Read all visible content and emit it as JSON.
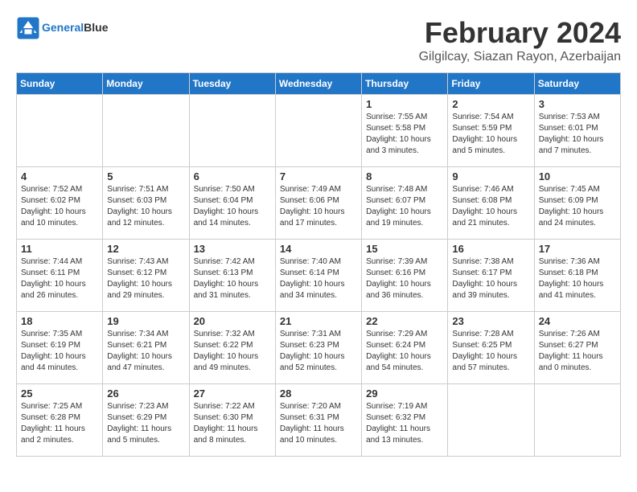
{
  "header": {
    "logo_general": "General",
    "logo_blue": "Blue",
    "month_title": "February 2024",
    "location": "Gilgilcay, Siazan Rayon, Azerbaijan"
  },
  "weekdays": [
    "Sunday",
    "Monday",
    "Tuesday",
    "Wednesday",
    "Thursday",
    "Friday",
    "Saturday"
  ],
  "weeks": [
    [
      {
        "day": "",
        "info": ""
      },
      {
        "day": "",
        "info": ""
      },
      {
        "day": "",
        "info": ""
      },
      {
        "day": "",
        "info": ""
      },
      {
        "day": "1",
        "info": "Sunrise: 7:55 AM\nSunset: 5:58 PM\nDaylight: 10 hours\nand 3 minutes."
      },
      {
        "day": "2",
        "info": "Sunrise: 7:54 AM\nSunset: 5:59 PM\nDaylight: 10 hours\nand 5 minutes."
      },
      {
        "day": "3",
        "info": "Sunrise: 7:53 AM\nSunset: 6:01 PM\nDaylight: 10 hours\nand 7 minutes."
      }
    ],
    [
      {
        "day": "4",
        "info": "Sunrise: 7:52 AM\nSunset: 6:02 PM\nDaylight: 10 hours\nand 10 minutes."
      },
      {
        "day": "5",
        "info": "Sunrise: 7:51 AM\nSunset: 6:03 PM\nDaylight: 10 hours\nand 12 minutes."
      },
      {
        "day": "6",
        "info": "Sunrise: 7:50 AM\nSunset: 6:04 PM\nDaylight: 10 hours\nand 14 minutes."
      },
      {
        "day": "7",
        "info": "Sunrise: 7:49 AM\nSunset: 6:06 PM\nDaylight: 10 hours\nand 17 minutes."
      },
      {
        "day": "8",
        "info": "Sunrise: 7:48 AM\nSunset: 6:07 PM\nDaylight: 10 hours\nand 19 minutes."
      },
      {
        "day": "9",
        "info": "Sunrise: 7:46 AM\nSunset: 6:08 PM\nDaylight: 10 hours\nand 21 minutes."
      },
      {
        "day": "10",
        "info": "Sunrise: 7:45 AM\nSunset: 6:09 PM\nDaylight: 10 hours\nand 24 minutes."
      }
    ],
    [
      {
        "day": "11",
        "info": "Sunrise: 7:44 AM\nSunset: 6:11 PM\nDaylight: 10 hours\nand 26 minutes."
      },
      {
        "day": "12",
        "info": "Sunrise: 7:43 AM\nSunset: 6:12 PM\nDaylight: 10 hours\nand 29 minutes."
      },
      {
        "day": "13",
        "info": "Sunrise: 7:42 AM\nSunset: 6:13 PM\nDaylight: 10 hours\nand 31 minutes."
      },
      {
        "day": "14",
        "info": "Sunrise: 7:40 AM\nSunset: 6:14 PM\nDaylight: 10 hours\nand 34 minutes."
      },
      {
        "day": "15",
        "info": "Sunrise: 7:39 AM\nSunset: 6:16 PM\nDaylight: 10 hours\nand 36 minutes."
      },
      {
        "day": "16",
        "info": "Sunrise: 7:38 AM\nSunset: 6:17 PM\nDaylight: 10 hours\nand 39 minutes."
      },
      {
        "day": "17",
        "info": "Sunrise: 7:36 AM\nSunset: 6:18 PM\nDaylight: 10 hours\nand 41 minutes."
      }
    ],
    [
      {
        "day": "18",
        "info": "Sunrise: 7:35 AM\nSunset: 6:19 PM\nDaylight: 10 hours\nand 44 minutes."
      },
      {
        "day": "19",
        "info": "Sunrise: 7:34 AM\nSunset: 6:21 PM\nDaylight: 10 hours\nand 47 minutes."
      },
      {
        "day": "20",
        "info": "Sunrise: 7:32 AM\nSunset: 6:22 PM\nDaylight: 10 hours\nand 49 minutes."
      },
      {
        "day": "21",
        "info": "Sunrise: 7:31 AM\nSunset: 6:23 PM\nDaylight: 10 hours\nand 52 minutes."
      },
      {
        "day": "22",
        "info": "Sunrise: 7:29 AM\nSunset: 6:24 PM\nDaylight: 10 hours\nand 54 minutes."
      },
      {
        "day": "23",
        "info": "Sunrise: 7:28 AM\nSunset: 6:25 PM\nDaylight: 10 hours\nand 57 minutes."
      },
      {
        "day": "24",
        "info": "Sunrise: 7:26 AM\nSunset: 6:27 PM\nDaylight: 11 hours\nand 0 minutes."
      }
    ],
    [
      {
        "day": "25",
        "info": "Sunrise: 7:25 AM\nSunset: 6:28 PM\nDaylight: 11 hours\nand 2 minutes."
      },
      {
        "day": "26",
        "info": "Sunrise: 7:23 AM\nSunset: 6:29 PM\nDaylight: 11 hours\nand 5 minutes."
      },
      {
        "day": "27",
        "info": "Sunrise: 7:22 AM\nSunset: 6:30 PM\nDaylight: 11 hours\nand 8 minutes."
      },
      {
        "day": "28",
        "info": "Sunrise: 7:20 AM\nSunset: 6:31 PM\nDaylight: 11 hours\nand 10 minutes."
      },
      {
        "day": "29",
        "info": "Sunrise: 7:19 AM\nSunset: 6:32 PM\nDaylight: 11 hours\nand 13 minutes."
      },
      {
        "day": "",
        "info": ""
      },
      {
        "day": "",
        "info": ""
      }
    ]
  ]
}
